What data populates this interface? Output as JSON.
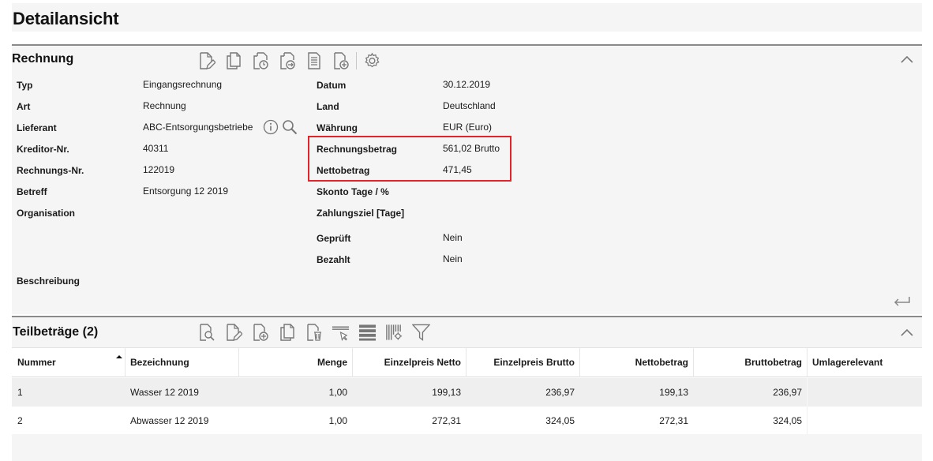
{
  "page": {
    "title": "Detailansicht"
  },
  "invoice": {
    "title": "Rechnung",
    "toolbar": [
      {
        "name": "edit-document-icon"
      },
      {
        "name": "copy-document-icon"
      },
      {
        "name": "document-clock-icon"
      },
      {
        "name": "document-forward-icon"
      },
      {
        "name": "document-text-icon"
      },
      {
        "name": "add-document-icon"
      },
      {
        "name": "settings-gear-icon"
      }
    ],
    "left_fields": [
      {
        "label": "Typ",
        "value": "Eingangsrechnung"
      },
      {
        "label": "Art",
        "value": "Rechnung"
      },
      {
        "label": "Lieferant",
        "value": "ABC-Entsorgungsbetriebe"
      },
      {
        "label": "Kreditor-Nr.",
        "value": "40311"
      },
      {
        "label": "Rechnungs-Nr.",
        "value": "122019"
      },
      {
        "label": "Betreff",
        "value": "Entsorgung 12 2019"
      },
      {
        "label": "Organisation",
        "value": ""
      },
      {
        "label": "Beschreibung",
        "value": ""
      }
    ],
    "right_fields": [
      {
        "label": "Datum",
        "value": "30.12.2019"
      },
      {
        "label": "Land",
        "value": "Deutschland"
      },
      {
        "label": "Währung",
        "value": "EUR (Euro)"
      },
      {
        "label": "Rechnungsbetrag",
        "value": "561,02 Brutto"
      },
      {
        "label": "Nettobetrag",
        "value": "471,45"
      },
      {
        "label": "Skonto Tage / %",
        "value": ""
      },
      {
        "label": "Zahlungsziel [Tage]",
        "value": ""
      },
      {
        "label": "Geprüft",
        "value": "Nein"
      },
      {
        "label": "Bezahlt",
        "value": "Nein"
      }
    ],
    "highlight_color": "#e1252b"
  },
  "partials": {
    "title": "Teilbeträge (2)",
    "toolbar": [
      {
        "name": "view-document-icon"
      },
      {
        "name": "edit-document-icon"
      },
      {
        "name": "add-document-icon"
      },
      {
        "name": "copy-document-icon"
      },
      {
        "name": "delete-document-icon"
      },
      {
        "name": "select-row-icon"
      },
      {
        "name": "rows-layout-icon"
      },
      {
        "name": "columns-settings-icon"
      },
      {
        "name": "filter-icon"
      }
    ],
    "columns": [
      "Nummer",
      "Bezeichnung",
      "Menge",
      "Einzelpreis Netto",
      "Einzelpreis Brutto",
      "Nettobetrag",
      "Bruttobetrag",
      "Umlagerelevant"
    ],
    "sort_column": "Nummer",
    "rows": [
      {
        "nummer": "1",
        "bezeichnung": "Wasser 12 2019",
        "menge": "1,00",
        "ep_netto": "199,13",
        "ep_brutto": "236,97",
        "netto": "199,13",
        "brutto": "236,97",
        "umlage": ""
      },
      {
        "nummer": "2",
        "bezeichnung": "Abwasser 12 2019",
        "menge": "1,00",
        "ep_netto": "272,31",
        "ep_brutto": "324,05",
        "netto": "272,31",
        "brutto": "324,05",
        "umlage": ""
      }
    ]
  }
}
